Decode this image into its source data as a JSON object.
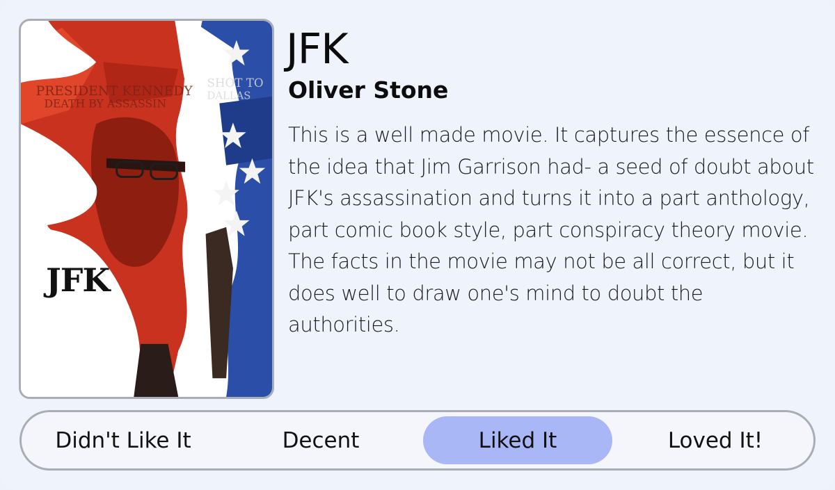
{
  "movie": {
    "title": "JFK",
    "director": "Oliver Stone",
    "review": "This is a well made movie. It captures the essence of the idea that Jim Garrison had- a seed of doubt about JFK's assassination and turns it into a part anthology, part comic book style, part conspiracy theory movie. The facts in the movie may not be all correct, but it does well to draw one's mind to doubt the authorities.",
    "poster": {
      "title_text": "JFK",
      "headline_left": "PRESIDENT KENNEDY",
      "headline_left_2": "DEATH BY ASSASSIN",
      "headline_right": "SHOT TO",
      "headline_right_2": "DALLAS"
    }
  },
  "rating": {
    "options": [
      {
        "label": "Didn't Like It",
        "selected": false
      },
      {
        "label": "Decent",
        "selected": false
      },
      {
        "label": "Liked It",
        "selected": true
      },
      {
        "label": "Loved It!",
        "selected": false
      }
    ],
    "selected_color": "#aab7f7"
  }
}
